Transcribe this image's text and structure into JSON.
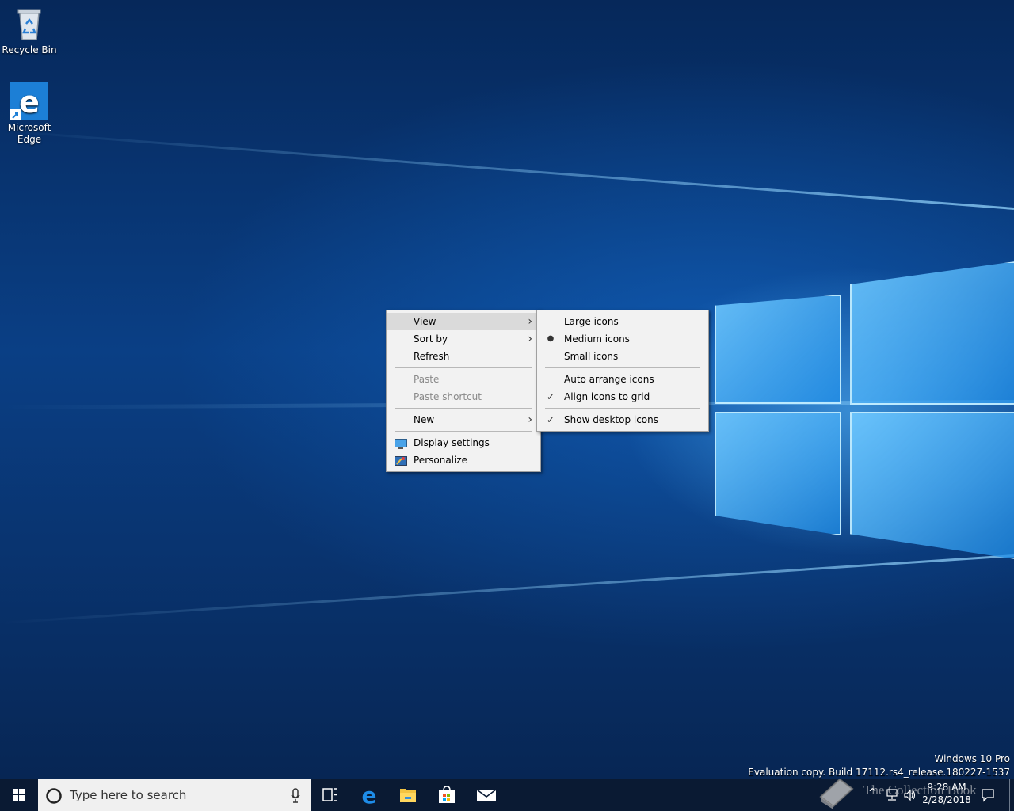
{
  "desktop": {
    "icons": [
      {
        "label": "Recycle Bin"
      },
      {
        "label": "Microsoft\nEdge"
      }
    ]
  },
  "context_menu": {
    "items": [
      {
        "label": "View",
        "submenu": true,
        "highlighted": true
      },
      {
        "label": "Sort by",
        "submenu": true
      },
      {
        "label": "Refresh"
      },
      {
        "label": "Paste",
        "disabled": true
      },
      {
        "label": "Paste shortcut",
        "disabled": true
      },
      {
        "label": "New",
        "submenu": true
      },
      {
        "label": "Display settings",
        "icon": "display-icon"
      },
      {
        "label": "Personalize",
        "icon": "personalize-icon"
      }
    ]
  },
  "view_submenu": {
    "items": [
      {
        "label": "Large icons"
      },
      {
        "label": "Medium icons",
        "mark": "bullet"
      },
      {
        "label": "Small icons"
      },
      {
        "label": "Auto arrange icons"
      },
      {
        "label": "Align icons to grid",
        "mark": "check"
      },
      {
        "label": "Show desktop icons",
        "mark": "check"
      }
    ]
  },
  "watermark": {
    "line1": "Windows 10 Pro",
    "line2": "Evaluation copy. Build 17112.rs4_release.180227-1537"
  },
  "taskbar": {
    "search_placeholder": "Type here to search",
    "clock_time": "9:28 AM",
    "clock_date": "2/28/2018",
    "overlay_logo_text": "The Collection Book",
    "accent": "#0078d7",
    "pinned_icons": [
      "task-view-icon",
      "edge-icon",
      "file-explorer-icon",
      "store-icon",
      "mail-icon"
    ]
  }
}
